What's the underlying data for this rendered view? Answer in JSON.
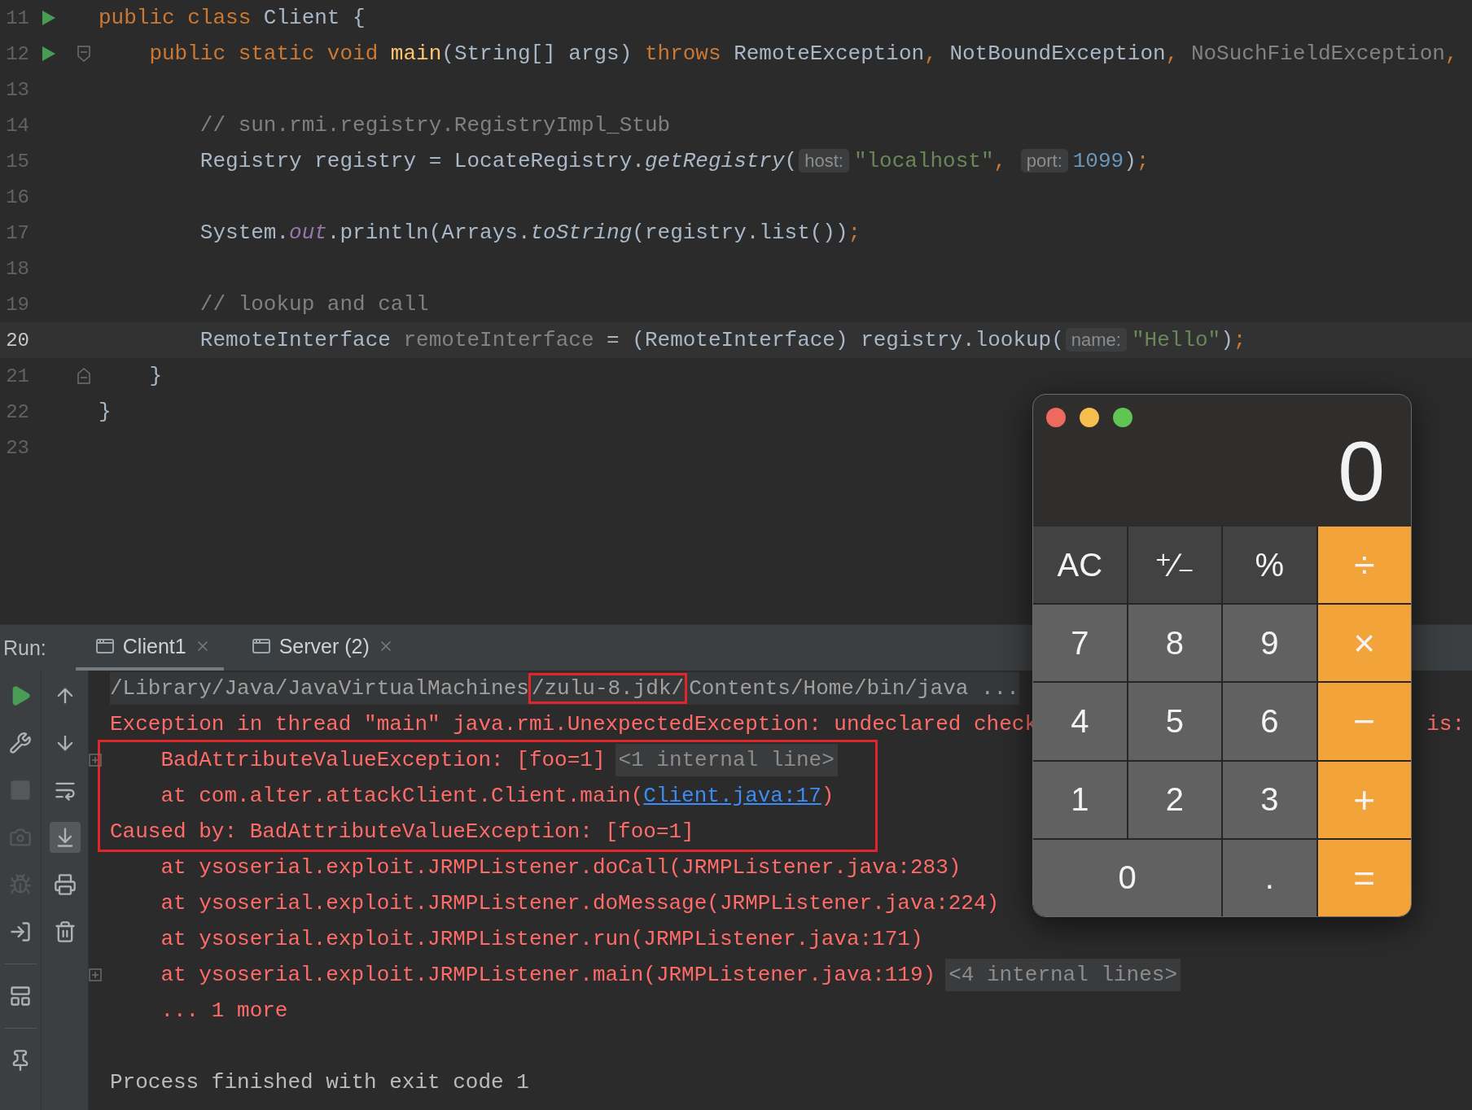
{
  "editor": {
    "lines": [
      {
        "number": "11",
        "runnable": true,
        "fold_start": false,
        "fold_end": false,
        "current": false,
        "tokens": [
          {
            "kind": "keyword",
            "text": "public class "
          },
          {
            "kind": "plain",
            "text": "Client {"
          }
        ]
      },
      {
        "number": "12",
        "runnable": true,
        "fold_start": true,
        "fold_end": false,
        "current": false,
        "tokens": [
          {
            "kind": "keyword",
            "text": "    public static void "
          },
          {
            "kind": "method",
            "text": "main"
          },
          {
            "kind": "plain",
            "text": "(String[] args) "
          },
          {
            "kind": "keyword",
            "text": "throws "
          },
          {
            "kind": "plain",
            "text": "RemoteException"
          },
          {
            "kind": "keyword",
            "text": ", "
          },
          {
            "kind": "plain",
            "text": "NotBoundException"
          },
          {
            "kind": "keyword",
            "text": ", "
          },
          {
            "kind": "unused",
            "text": "NoSuchFieldException"
          },
          {
            "kind": "keyword",
            "text": ","
          }
        ]
      },
      {
        "number": "13",
        "runnable": false,
        "fold_start": false,
        "fold_end": false,
        "current": false
      },
      {
        "number": "14",
        "runnable": false,
        "fold_start": false,
        "fold_end": false,
        "current": false,
        "tokens": [
          {
            "kind": "comment",
            "text": "        // sun.rmi.registry.RegistryImpl_Stub"
          }
        ]
      },
      {
        "number": "15",
        "runnable": false,
        "fold_start": false,
        "fold_end": false,
        "current": false,
        "tokens": [
          {
            "kind": "plain",
            "text": "        Registry registry = LocateRegistry."
          },
          {
            "kind": "call",
            "text": "getRegistry"
          },
          {
            "kind": "plain",
            "text": "("
          },
          {
            "kind": "hint",
            "text": "host:"
          },
          {
            "kind": "string",
            "text": "\"localhost\""
          },
          {
            "kind": "keyword",
            "text": ", "
          },
          {
            "kind": "hint",
            "text": "port:"
          },
          {
            "kind": "number",
            "text": "1099"
          },
          {
            "kind": "plain",
            "text": ")"
          },
          {
            "kind": "keyword",
            "text": ";"
          }
        ]
      },
      {
        "number": "16",
        "runnable": false,
        "fold_start": false,
        "fold_end": false,
        "current": false
      },
      {
        "number": "17",
        "runnable": false,
        "fold_start": false,
        "fold_end": false,
        "current": false,
        "tokens": [
          {
            "kind": "plain",
            "text": "        System."
          },
          {
            "kind": "field",
            "text": "out"
          },
          {
            "kind": "plain",
            "text": ".println(Arrays."
          },
          {
            "kind": "call",
            "text": "toString"
          },
          {
            "kind": "plain",
            "text": "(registry.list())"
          },
          {
            "kind": "keyword",
            "text": ";"
          }
        ]
      },
      {
        "number": "18",
        "runnable": false,
        "fold_start": false,
        "fold_end": false,
        "current": false
      },
      {
        "number": "19",
        "runnable": false,
        "fold_start": false,
        "fold_end": false,
        "current": false,
        "tokens": [
          {
            "kind": "comment",
            "text": "        // lookup and call"
          }
        ]
      },
      {
        "number": "20",
        "runnable": false,
        "fold_start": false,
        "fold_end": false,
        "current": true,
        "tokens": [
          {
            "kind": "plain",
            "text": "        RemoteInterface "
          },
          {
            "kind": "unused",
            "text": "remoteInterface"
          },
          {
            "kind": "plain",
            "text": " = (RemoteInterface) registry.lookup("
          },
          {
            "kind": "hint",
            "text": "name:"
          },
          {
            "kind": "string",
            "text": "\"Hello\""
          },
          {
            "kind": "plain",
            "text": ")"
          },
          {
            "kind": "keyword",
            "text": ";"
          }
        ]
      },
      {
        "number": "21",
        "runnable": false,
        "fold_start": false,
        "fold_end": true,
        "current": false,
        "tokens": [
          {
            "kind": "plain",
            "text": "    }"
          }
        ]
      },
      {
        "number": "22",
        "runnable": false,
        "fold_start": false,
        "fold_end": false,
        "current": false,
        "tokens": [
          {
            "kind": "plain",
            "text": "}"
          }
        ]
      },
      {
        "number": "23",
        "runnable": false,
        "fold_start": false,
        "fold_end": false,
        "current": false
      }
    ]
  },
  "run_panel": {
    "label": "Run:",
    "tabs": [
      {
        "label": "Client1",
        "selected": true
      },
      {
        "label": "Server (2)",
        "selected": false
      }
    ],
    "run_toolbar": [
      {
        "disabled": false
      },
      {
        "disabled": false
      },
      {
        "disabled": true
      },
      {
        "disabled": true
      },
      {
        "disabled": true
      },
      {
        "disabled": false
      },
      {
        "disabled": false
      },
      {
        "disabled": false
      }
    ],
    "output_toolbar": [
      {
        "selected": false
      },
      {
        "selected": false
      },
      {
        "selected": false
      },
      {
        "selected": true
      },
      {
        "selected": false
      },
      {
        "selected": false
      }
    ],
    "console": [
      {
        "kind": "command",
        "foldable": false,
        "framed": false,
        "parts": [
          {
            "kind": "text",
            "text": "/Library/Java/JavaVirtualMachines"
          },
          {
            "kind": "boxed",
            "text": "/zulu-8.jdk/"
          },
          {
            "kind": "text",
            "text": "Contents/Home/bin/java ..."
          }
        ]
      },
      {
        "kind": "error",
        "foldable": false,
        "framed": false,
        "parts": [
          {
            "kind": "text",
            "text": "Exception in thread \"main\" java.rmi.UnexpectedException: undeclared check"
          },
          {
            "kind": "tail",
            "text": "is:"
          }
        ]
      },
      {
        "kind": "error",
        "foldable": true,
        "framed": true,
        "parts": [
          {
            "kind": "text",
            "text": "    BadAttributeValueException: [foo=1]"
          },
          {
            "kind": "collapsed",
            "text": "<1 internal line>"
          }
        ]
      },
      {
        "kind": "error",
        "foldable": false,
        "framed": true,
        "parts": [
          {
            "kind": "text",
            "text": "    at com.alter.attackClient.Client.main("
          },
          {
            "kind": "link",
            "text": "Client.java:17"
          },
          {
            "kind": "text",
            "text": ")"
          }
        ]
      },
      {
        "kind": "error",
        "foldable": false,
        "framed": true,
        "parts": [
          {
            "kind": "text",
            "text": "Caused by: BadAttributeValueException: [foo=1]"
          }
        ]
      },
      {
        "kind": "error",
        "foldable": false,
        "framed": false,
        "parts": [
          {
            "kind": "text",
            "text": "    at ysoserial.exploit.JRMPListener.doCall(JRMPListener.java:283)"
          }
        ]
      },
      {
        "kind": "error",
        "foldable": false,
        "framed": false,
        "parts": [
          {
            "kind": "text",
            "text": "    at ysoserial.exploit.JRMPListener.doMessage(JRMPListener.java:224)"
          }
        ]
      },
      {
        "kind": "error",
        "foldable": false,
        "framed": false,
        "parts": [
          {
            "kind": "text",
            "text": "    at ysoserial.exploit.JRMPListener.run(JRMPListener.java:171)"
          }
        ]
      },
      {
        "kind": "error",
        "foldable": true,
        "framed": false,
        "parts": [
          {
            "kind": "text",
            "text": "    at ysoserial.exploit.JRMPListener.main(JRMPListener.java:119)"
          },
          {
            "kind": "collapsed",
            "text": "<4 internal lines>"
          }
        ]
      },
      {
        "kind": "error",
        "foldable": false,
        "framed": false,
        "parts": [
          {
            "kind": "text",
            "text": "    ... 1 more"
          }
        ]
      },
      {
        "kind": "blank",
        "foldable": false,
        "framed": false
      },
      {
        "kind": "output",
        "foldable": false,
        "framed": false,
        "parts": [
          {
            "kind": "text",
            "text": "Process finished with exit code 1"
          }
        ]
      }
    ]
  },
  "calculator": {
    "display": "0",
    "keys": [
      {
        "label": "AC",
        "kind": "function",
        "wide": false
      },
      {
        "label": "⁺∕₋",
        "kind": "function",
        "wide": false
      },
      {
        "label": "%",
        "kind": "function",
        "wide": false
      },
      {
        "label": "÷",
        "kind": "operator",
        "wide": false
      },
      {
        "label": "7",
        "kind": "digit",
        "wide": false
      },
      {
        "label": "8",
        "kind": "digit",
        "wide": false
      },
      {
        "label": "9",
        "kind": "digit",
        "wide": false
      },
      {
        "label": "×",
        "kind": "operator",
        "wide": false
      },
      {
        "label": "4",
        "kind": "digit",
        "wide": false
      },
      {
        "label": "5",
        "kind": "digit",
        "wide": false
      },
      {
        "label": "6",
        "kind": "digit",
        "wide": false
      },
      {
        "label": "−",
        "kind": "operator",
        "wide": false
      },
      {
        "label": "1",
        "kind": "digit",
        "wide": false
      },
      {
        "label": "2",
        "kind": "digit",
        "wide": false
      },
      {
        "label": "3",
        "kind": "digit",
        "wide": false
      },
      {
        "label": "+",
        "kind": "operator",
        "wide": false
      },
      {
        "label": "0",
        "kind": "digit",
        "wide": true
      },
      {
        "label": ".",
        "kind": "digit",
        "wide": false
      },
      {
        "label": "=",
        "kind": "operator",
        "wide": false
      }
    ]
  }
}
